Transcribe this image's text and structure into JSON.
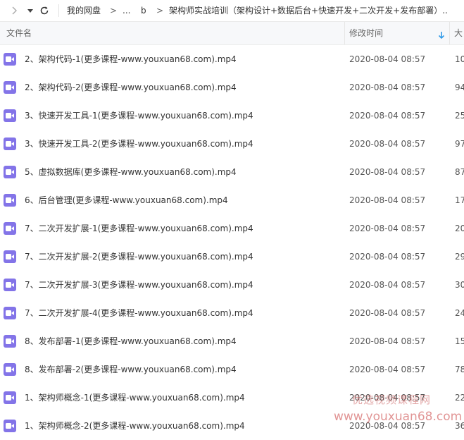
{
  "toolbar": {
    "forward_icon": "chevron-right-icon",
    "menu_icon": "chevron-down-icon",
    "refresh_icon": "refresh-icon",
    "breadcrumb": [
      "我的网盘",
      "...",
      "b",
      "架构师实战培训（架构设计+数据后台+快速开发+二次开发+发布部署）..."
    ],
    "breadcrumb_separator": ">"
  },
  "columns": {
    "name": "文件名",
    "modified": "修改时间",
    "size": "大",
    "sort_icon": "arrow-down-icon"
  },
  "files": [
    {
      "name": "2、架构代码-1(更多课程-www.youxuan68.com).mp4",
      "modified": "2020-08-04 08:57",
      "size": "10"
    },
    {
      "name": "2、架构代码-2(更多课程-www.youxuan68.com).mp4",
      "modified": "2020-08-04 08:57",
      "size": "94"
    },
    {
      "name": "3、快速开发工具-1(更多课程-www.youxuan68.com).mp4",
      "modified": "2020-08-04 08:57",
      "size": "25"
    },
    {
      "name": "3、快速开发工具-2(更多课程-www.youxuan68.com).mp4",
      "modified": "2020-08-04 08:57",
      "size": "97"
    },
    {
      "name": "5、虚拟数据库(更多课程-www.youxuan68.com).mp4",
      "modified": "2020-08-04 08:57",
      "size": "87"
    },
    {
      "name": "6、后台管理(更多课程-www.youxuan68.com).mp4",
      "modified": "2020-08-04 08:57",
      "size": "17"
    },
    {
      "name": "7、二次开发扩展-1(更多课程-www.youxuan68.com).mp4",
      "modified": "2020-08-04 08:57",
      "size": "20"
    },
    {
      "name": "7、二次开发扩展-2(更多课程-www.youxuan68.com).mp4",
      "modified": "2020-08-04 08:57",
      "size": "29"
    },
    {
      "name": "7、二次开发扩展-3(更多课程-www.youxuan68.com).mp4",
      "modified": "2020-08-04 08:57",
      "size": "30"
    },
    {
      "name": "7、二次开发扩展-4(更多课程-www.youxuan68.com).mp4",
      "modified": "2020-08-04 08:57",
      "size": "24"
    },
    {
      "name": "8、发布部署-1(更多课程-www.youxuan68.com).mp4",
      "modified": "2020-08-04 08:57",
      "size": "15"
    },
    {
      "name": "8、发布部署-2(更多课程-www.youxuan68.com).mp4",
      "modified": "2020-08-04 08:57",
      "size": "78"
    },
    {
      "name": "1、架构师概念-1(更多课程-www.youxuan68.com).mp4",
      "modified": "2020-08-04 08:57",
      "size": "22"
    },
    {
      "name": "1、架构师概念-2(更多课程-www.youxuan68.com).mp4",
      "modified": "2020-08-04 08:57",
      "size": "36"
    }
  ],
  "file_icon": "video-file-icon",
  "watermark": {
    "line1": "优选视频课程网",
    "line2": "www.youxuan68.com"
  },
  "colors": {
    "file_icon": "#8374e8",
    "sort_arrow": "#2f9ae8",
    "header_bg": "#f7f8fa"
  }
}
